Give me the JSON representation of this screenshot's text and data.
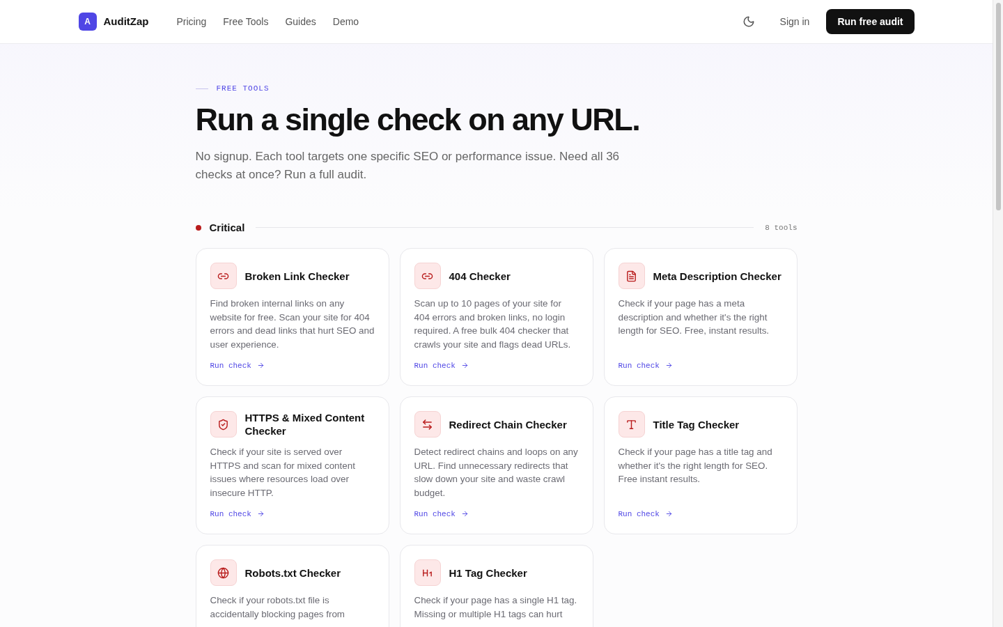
{
  "nav": {
    "logo_mark": "A",
    "brand": "AuditZap",
    "links": [
      "Pricing",
      "Free Tools",
      "Guides",
      "Demo"
    ],
    "sign_in": "Sign in",
    "cta": "Run free audit"
  },
  "hero": {
    "eyebrow": "FREE TOOLS",
    "title": "Run a single check on any URL.",
    "subtitle": "No signup. Each tool targets one specific SEO or performance issue. Need all 36 checks at once? Run a full audit."
  },
  "section": {
    "title": "Critical",
    "color": "#b91c1c",
    "count": "8 tools",
    "tools": [
      {
        "name": "Broken Link Checker",
        "description": "Find broken internal links on any website for free. Scan your site for 404 errors and dead links that hurt SEO and user experience.",
        "action": "Run check"
      },
      {
        "name": "404 Checker",
        "description": "Scan up to 10 pages of your site for 404 errors and broken links, no login required. A free bulk 404 checker that crawls your site and flags dead URLs.",
        "action": "Run check"
      },
      {
        "name": "Meta Description Checker",
        "description": "Check if your page has a meta description and whether it's the right length for SEO. Free, instant results.",
        "action": "Run check"
      },
      {
        "name": "HTTPS & Mixed Content Checker",
        "description": "Check if your site is served over HTTPS and scan for mixed content issues where resources load over insecure HTTP.",
        "action": "Run check"
      },
      {
        "name": "Redirect Chain Checker",
        "description": "Detect redirect chains and loops on any URL. Find unnecessary redirects that slow down your site and waste crawl budget.",
        "action": "Run check"
      },
      {
        "name": "Title Tag Checker",
        "description": "Check if your page has a title tag and whether it's the right length for SEO. Free instant results.",
        "action": "Run check"
      },
      {
        "name": "Robots.txt Checker",
        "description": "Check if your robots.txt file is accidentally blocking pages from"
      },
      {
        "name": "H1 Tag Checker",
        "description": "Check if your page has a single H1 tag. Missing or multiple H1 tags can hurt"
      }
    ]
  }
}
